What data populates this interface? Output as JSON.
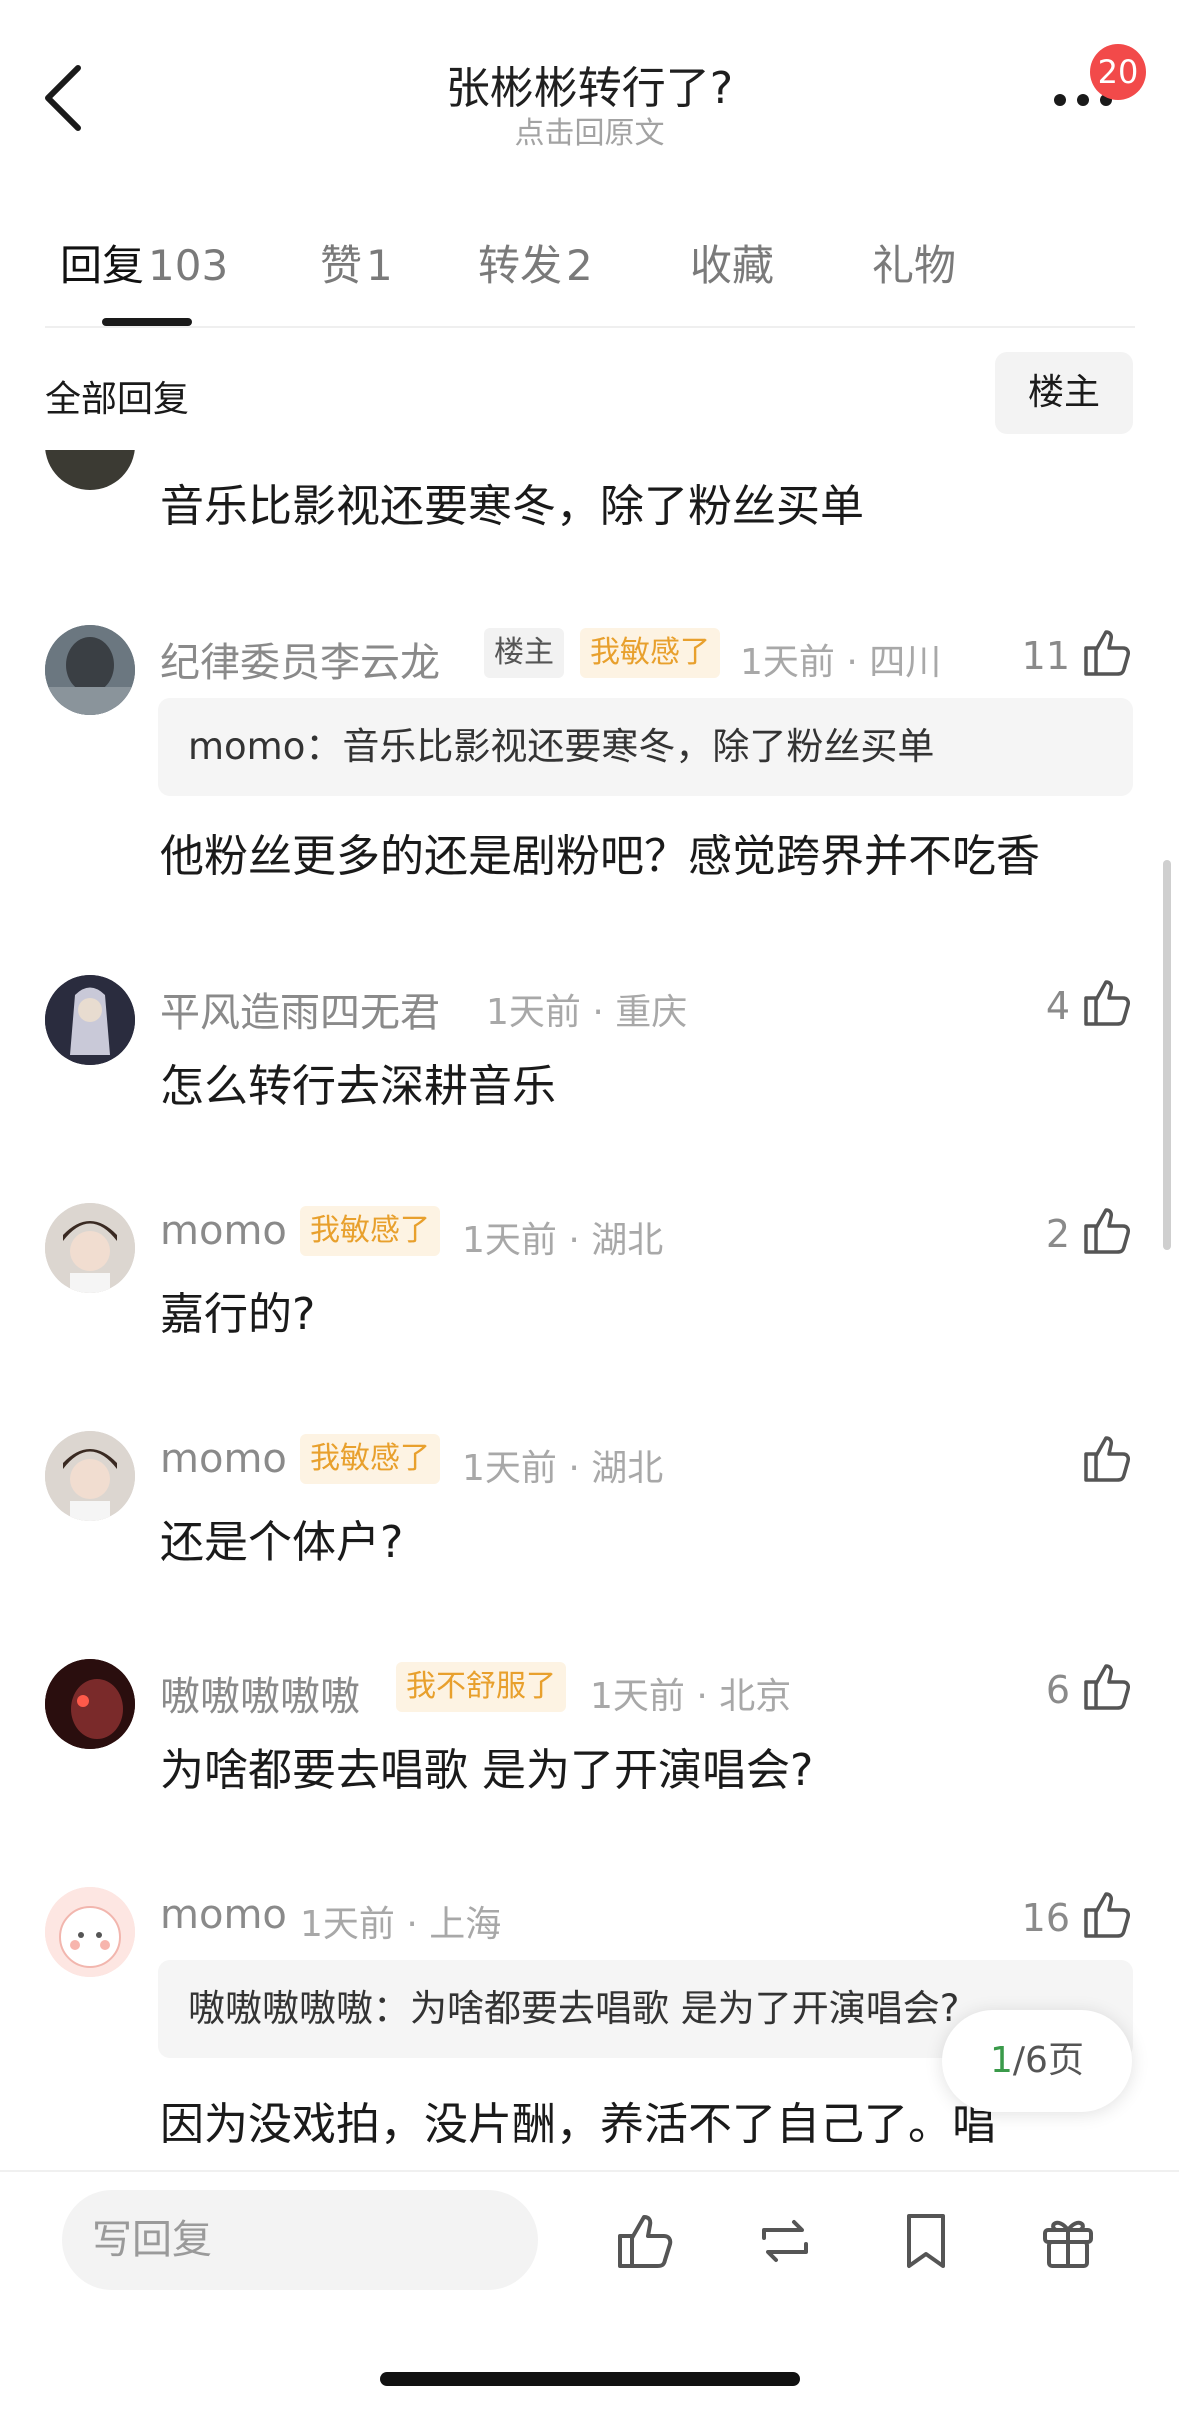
{
  "header": {
    "title": "张彬彬转行了?",
    "subtitle": "点击回原文",
    "notification_count": "20"
  },
  "tabs": [
    {
      "label": "回复",
      "count": "103",
      "active": true
    },
    {
      "label": "赞",
      "count": "1"
    },
    {
      "label": "转发",
      "count": "2"
    },
    {
      "label": "收藏",
      "count": ""
    },
    {
      "label": "礼物",
      "count": ""
    }
  ],
  "filter": {
    "all_label": "全部回复",
    "op_label": "楼主"
  },
  "comments": [
    {
      "body": "音乐比影视还要寒冬，除了粉丝买单"
    },
    {
      "user": "纪律委员李云龙",
      "tags": [
        "楼主",
        "我敏感了"
      ],
      "time": "1天前 · 四川",
      "likes": "11",
      "quote_user": "momo：",
      "quote_text": "音乐比影视还要寒冬，除了粉丝买单",
      "body": "他粉丝更多的还是剧粉吧？感觉跨界并不吃香"
    },
    {
      "user": "平风造雨四无君",
      "time": "1天前 · 重庆",
      "likes": "4",
      "body": "怎么转行去深耕音乐"
    },
    {
      "user": "momo",
      "tags": [
        "我敏感了"
      ],
      "time": "1天前 · 湖北",
      "likes": "2",
      "body": "嘉行的?"
    },
    {
      "user": "momo",
      "tags": [
        "我敏感了"
      ],
      "time": "1天前 · 湖北",
      "likes": "",
      "body": "还是个体户?"
    },
    {
      "user": "嗷嗷嗷嗷嗷",
      "tags": [
        "我不舒服了"
      ],
      "time": "1天前 · 北京",
      "likes": "6",
      "body": "为啥都要去唱歌 是为了开演唱会?"
    },
    {
      "user": "momo",
      "time": "1天前 · 上海",
      "likes": "16",
      "quote_user": "嗷嗷嗷嗷嗷：",
      "quote_text": "为啥都要去唱歌 是为了开演唱会?",
      "body": "因为没戏拍，没片酬，养活不了自己了。唱"
    }
  ],
  "pagination": {
    "current": "1",
    "total": "/6页"
  },
  "bottom_bar": {
    "reply_placeholder": "写回复"
  },
  "colors": {
    "accent_green": "#3a9a4a",
    "badge_red": "#f24a4a",
    "tag_orange": "#e8a02d"
  }
}
